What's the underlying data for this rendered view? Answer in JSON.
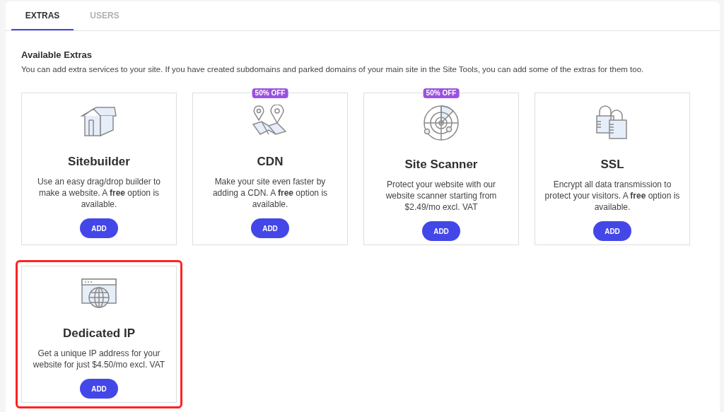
{
  "tabs": [
    {
      "label": "EXTRAS",
      "selected": true
    },
    {
      "label": "USERS",
      "selected": false
    }
  ],
  "section": {
    "title": "Available Extras",
    "description": "You can add extra services to your site. If you have created subdomains and parked domains of your main site in the Site Tools, you can add some of the extras for them too."
  },
  "cards": [
    {
      "kind": "house",
      "title": "Sitebuilder",
      "description": "Use an easy drag/drop builder to make a website. A **free** option is available.",
      "button": "ADD",
      "highlighted": false
    },
    {
      "kind": "map",
      "badge": "50% OFF",
      "title": "CDN",
      "description": "Make your site even faster by adding a CDN. A **free** option is available.",
      "button": "ADD",
      "highlighted": false
    },
    {
      "kind": "radar",
      "badge": "50% OFF",
      "title": "Site Scanner",
      "description": "Protect your website with our website scanner starting from $2.49/mo excl. VAT",
      "button": "ADD",
      "highlighted": false
    },
    {
      "kind": "locks",
      "title": "SSL",
      "description": "Encrypt all data transmission to protect your visitors. A **free** option is available.",
      "button": "ADD",
      "highlighted": false
    },
    {
      "kind": "globe",
      "title": "Dedicated IP",
      "description": "Get a unique IP address for your website for just $4.50/mo excl. VAT",
      "button": "ADD",
      "highlighted": true
    }
  ]
}
